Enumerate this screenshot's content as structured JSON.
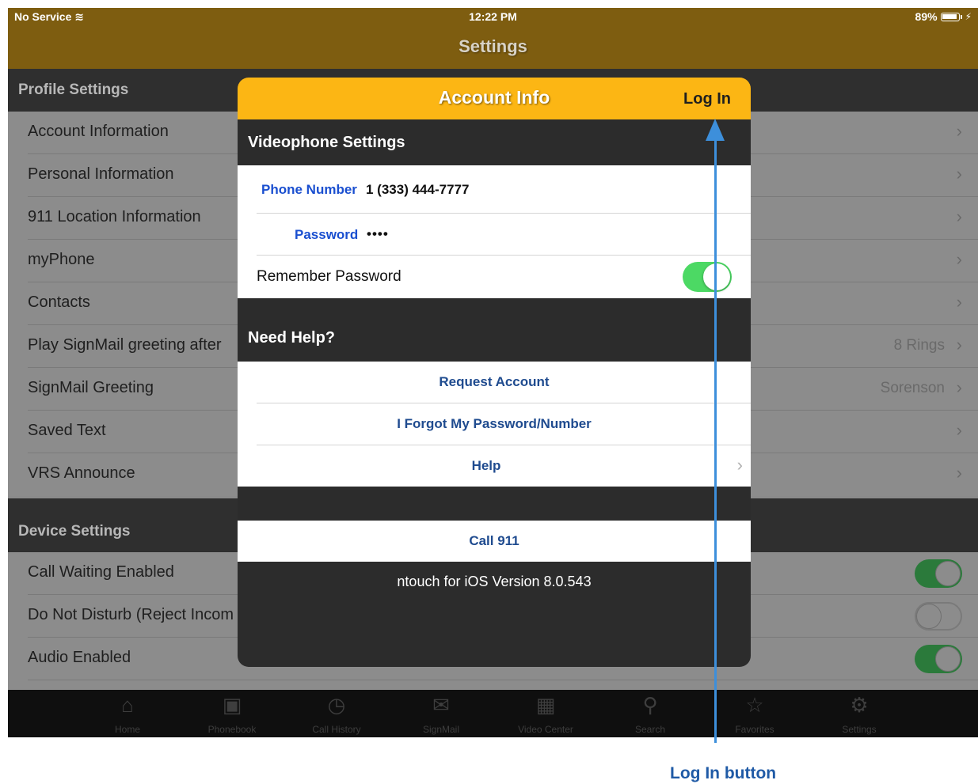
{
  "status_bar": {
    "carrier": "No Service",
    "wifi_icon": "wifi-icon",
    "time": "12:22 PM",
    "battery": "89%"
  },
  "nav": {
    "title": "Settings"
  },
  "settings": {
    "profile_header": "Profile Settings",
    "profile_rows": [
      {
        "label": "Account Information",
        "value": ""
      },
      {
        "label": "Personal Information",
        "value": ""
      },
      {
        "label": "911 Location Information",
        "value": ""
      },
      {
        "label": "myPhone",
        "value": ""
      },
      {
        "label": "Contacts",
        "value": ""
      },
      {
        "label": "Play SignMail greeting after",
        "value": "8 Rings"
      },
      {
        "label": "SignMail Greeting",
        "value": "Sorenson"
      },
      {
        "label": "Saved Text",
        "value": ""
      },
      {
        "label": "VRS Announce",
        "value": ""
      }
    ],
    "device_header": "Device Settings",
    "device_rows": [
      {
        "label": "Call Waiting Enabled",
        "on": true
      },
      {
        "label": "Do Not Disturb (Reject Incom",
        "on": false
      },
      {
        "label": "Audio Enabled",
        "on": true
      }
    ]
  },
  "modal": {
    "title": "Account Info",
    "login_label": "Log In",
    "videophone_header": "Videophone Settings",
    "phone_label": "Phone Number",
    "phone_value": "1 (333) 444-7777",
    "password_label": "Password",
    "password_value": "••••",
    "remember_label": "Remember Password",
    "remember_on": true,
    "help_header": "Need Help?",
    "request_account": "Request Account",
    "forgot": "I Forgot My Password/Number",
    "help": "Help",
    "call911": "Call 911",
    "version": "ntouch for iOS Version 8.0.543"
  },
  "tabs": [
    {
      "label": "Home",
      "icon": "home-icon"
    },
    {
      "label": "Phonebook",
      "icon": "phonebook-icon"
    },
    {
      "label": "Call History",
      "icon": "call-history-icon"
    },
    {
      "label": "SignMail",
      "icon": "signmail-icon"
    },
    {
      "label": "Video Center",
      "icon": "video-center-icon"
    },
    {
      "label": "Search",
      "icon": "search-icon"
    },
    {
      "label": "Favorites",
      "icon": "favorites-icon"
    },
    {
      "label": "Settings",
      "icon": "settings-icon"
    }
  ],
  "annotation": {
    "callout": "Log In button"
  },
  "colors": {
    "nav_brown": "#7e5d10",
    "modal_header": "#fcb614",
    "toggle_green": "#4cd964",
    "link_blue": "#1f4b8f",
    "arrow_blue": "#3d8fdb"
  }
}
